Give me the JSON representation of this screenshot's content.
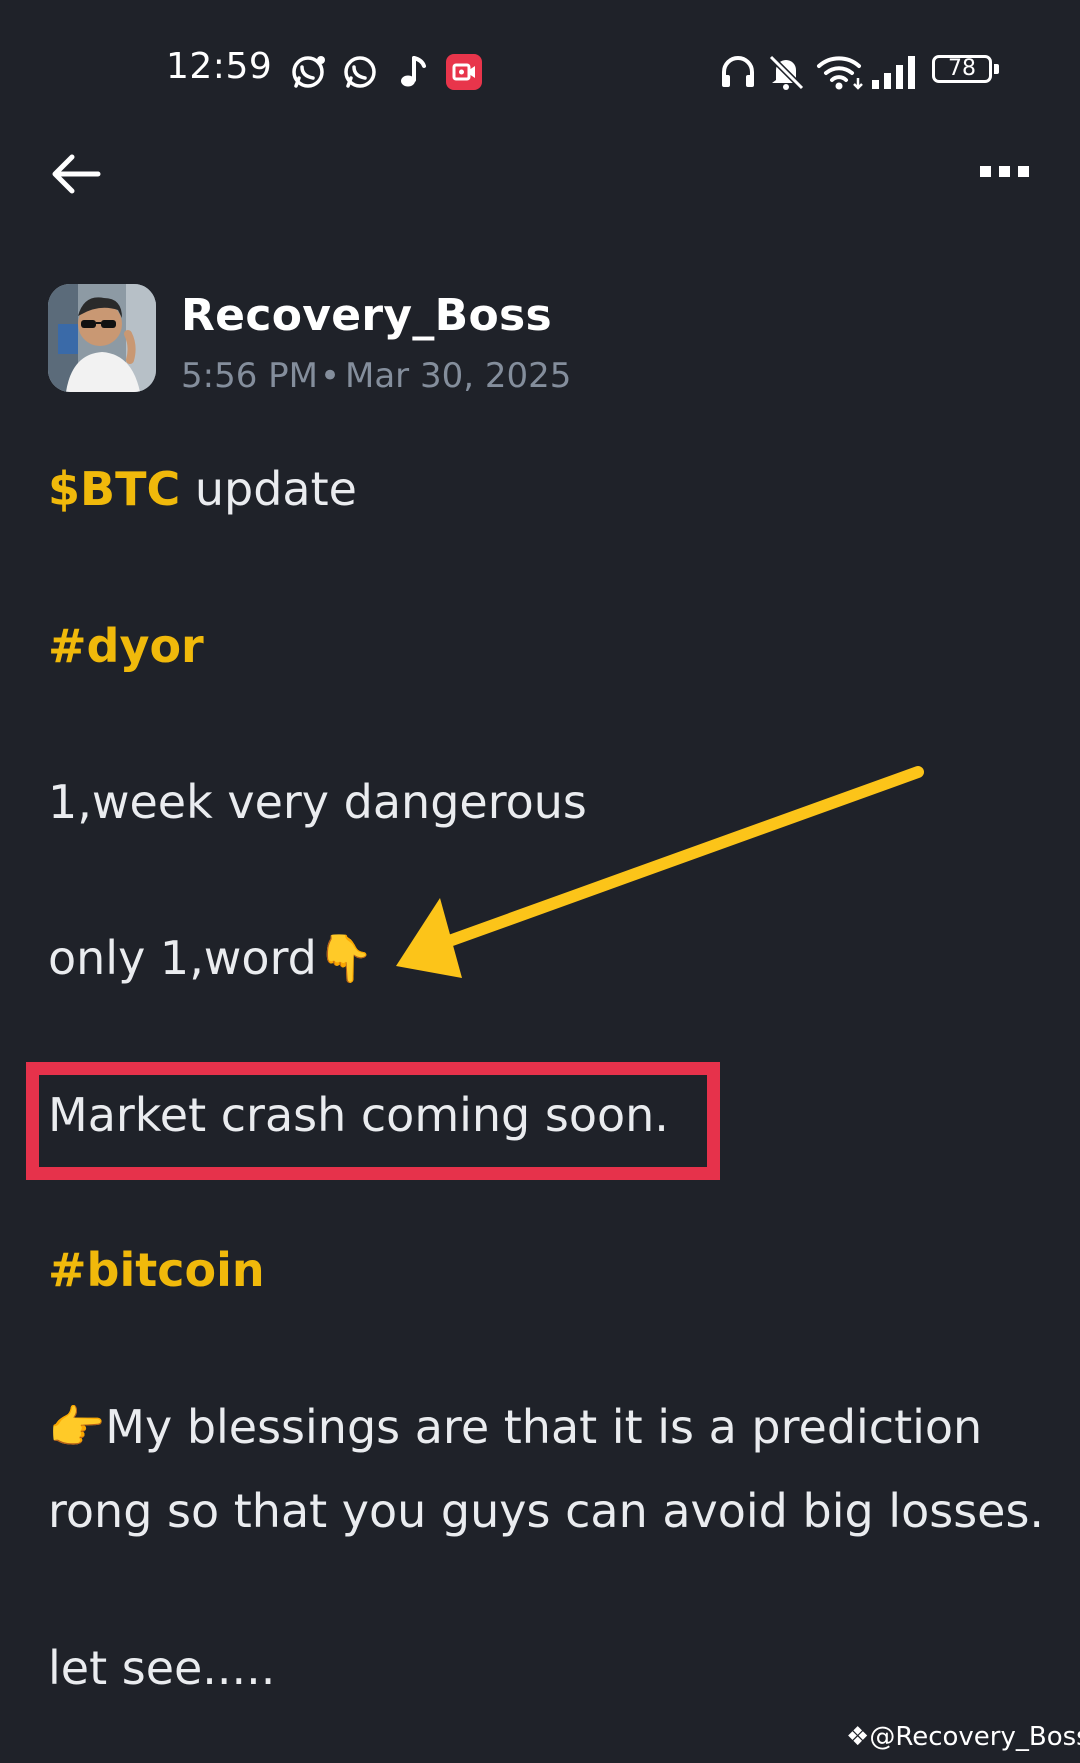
{
  "status_bar": {
    "time": "12:59",
    "battery": "78",
    "left_icons": [
      "whatsapp-business-icon",
      "whatsapp-icon",
      "music-note-icon",
      "screen-record-icon"
    ],
    "right_icons": [
      "headphones-icon",
      "bell-muted-icon",
      "wifi-icon",
      "signal-icon",
      "battery-icon"
    ]
  },
  "nav": {
    "back_icon": "arrow-left-icon",
    "more_icon": "more-dots-icon"
  },
  "post": {
    "author": "Recovery_Boss",
    "time": "5:56 PM",
    "separator": "•",
    "date": "Mar 30, 2025",
    "ticker": "$BTC",
    "line1_rest": "update",
    "hashtag1": "#dyor",
    "line3": "1,week very dangerous",
    "line4": "only 1,word",
    "line4_emoji": "👇",
    "highlighted": "Market crash coming soon.",
    "hashtag2": "#bitcoin",
    "line6_emoji": "👉",
    "line6a": "My blessings are that it is a prediction",
    "line6b": "rong so that you guys can avoid big losses.",
    "line7": "let see....."
  },
  "watermark": "@Recovery_Boss",
  "colors": {
    "background": "#1f2229",
    "accent_gold": "#f0b90b",
    "highlight_red": "#e6324b",
    "muted_text": "#848e9c",
    "arrow_yellow": "#fcc419"
  }
}
